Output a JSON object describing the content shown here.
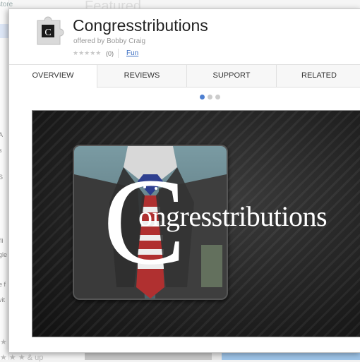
{
  "background": {
    "store_label": "store",
    "featured_label": "Featured",
    "fragments": [
      "A",
      "s",
      "S",
      "fli",
      "gle",
      "e f",
      "vit",
      "& up"
    ]
  },
  "app": {
    "title": "Congresstributions",
    "byline": "offered by Bobby Craig",
    "rating_count": "(0)",
    "category": "Fun",
    "icon": "puzzle-piece-icon",
    "icon_letter": "C"
  },
  "tabs": [
    {
      "label": "OVERVIEW",
      "active": true
    },
    {
      "label": "REVIEWS",
      "active": false
    },
    {
      "label": "SUPPORT",
      "active": false
    },
    {
      "label": "RELATED",
      "active": false
    }
  ],
  "carousel": {
    "count": 3,
    "active_index": 0
  },
  "promo": {
    "big_letter": "C",
    "text": "ongresstributions"
  },
  "colors": {
    "link": "#3b6ec2",
    "active_dot": "#4d7fd1"
  }
}
